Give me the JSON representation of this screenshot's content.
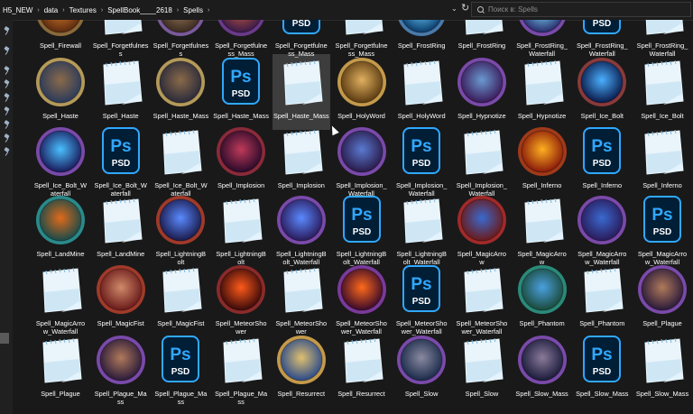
{
  "breadcrumb": [
    "H5_NEW",
    "data",
    "Textures",
    "SpellBook____2618",
    "Spells"
  ],
  "search": {
    "placeholder": "Поиск в: Spells"
  },
  "colors": {
    "background": "#191919",
    "selection": "#3d3d3d",
    "ps_blue": "#31a8ff",
    "ps_bg": "#001e36"
  },
  "icons": {
    "notepad": "notepad-file-icon",
    "psd": "photoshop-psd-icon",
    "spell": "spell-icon"
  },
  "files": [
    [
      {
        "label": "Spell_Firewall",
        "type": "spell",
        "c1": "#d77a2a",
        "c2": "#5a2a10",
        "ring": "#8a6a3a"
      },
      {
        "label": "Spell_Forgetfulnes\ns",
        "type": "notepad"
      },
      {
        "label": "Spell_Forgetfulnes\ns",
        "type": "spell",
        "c1": "#9a7a5a",
        "c2": "#3a2a20",
        "ring": "#7a5a9a"
      },
      {
        "label": "Spell_Forgetfulne\nss_Mass",
        "type": "spell",
        "c1": "#c45a3a",
        "c2": "#3a1a4a",
        "ring": "#6a3a8a"
      },
      {
        "label": "Spell_Forgetfulne\nss_Mass",
        "type": "psd"
      },
      {
        "label": "Spell_Forgetfulne\nss_Mass",
        "type": "notepad"
      },
      {
        "label": "Spell_FrostRing",
        "type": "spell",
        "c1": "#6ad0ff",
        "c2": "#0a3a6a",
        "ring": "#4a7aaa"
      },
      {
        "label": "Spell_FrostRing",
        "type": "notepad"
      },
      {
        "label": "Spell_FrostRing_\nWaterfall",
        "type": "spell",
        "c1": "#7ae0ff",
        "c2": "#2a2a6a",
        "ring": "#7a4aaa"
      },
      {
        "label": "Spell_FrostRing_\nWaterfall",
        "type": "psd"
      },
      {
        "label": "Spell_FrostRing_\nWaterfall",
        "type": "notepad"
      }
    ],
    [
      {
        "label": "Spell_Haste",
        "type": "spell",
        "c1": "#8a6a4a",
        "c2": "#2a3a5a",
        "ring": "#b49a5a"
      },
      {
        "label": "Spell_Haste",
        "type": "notepad"
      },
      {
        "label": "Spell_Haste_Mass",
        "type": "spell",
        "c1": "#8a6a4a",
        "c2": "#2a2a3a",
        "ring": "#b49a5a"
      },
      {
        "label": "Spell_Haste_Mass",
        "type": "psd"
      },
      {
        "label": "Spell_Haste_Mass",
        "type": "notepad",
        "selected": true
      },
      {
        "label": "Spell_HolyWord",
        "type": "spell",
        "c1": "#e0b060",
        "c2": "#5a3a10",
        "ring": "#c49a4a"
      },
      {
        "label": "Spell_HolyWord",
        "type": "notepad"
      },
      {
        "label": "Spell_Hypnotize",
        "type": "spell",
        "c1": "#6a9ad0",
        "c2": "#3a1a5a",
        "ring": "#7a4aaa"
      },
      {
        "label": "Spell_Hypnotize",
        "type": "notepad"
      },
      {
        "label": "Spell_Ice_Bolt",
        "type": "spell",
        "c1": "#4ab0ff",
        "c2": "#0a1a4a",
        "ring": "#8a3a3a"
      },
      {
        "label": "Spell_Ice_Bolt",
        "type": "notepad"
      }
    ],
    [
      {
        "label": "Spell_Ice_Bolt_W\naterfall",
        "type": "spell",
        "c1": "#4ac0ff",
        "c2": "#1a1a5a",
        "ring": "#7a4aaa"
      },
      {
        "label": "Spell_Ice_Bolt_W\naterfall",
        "type": "psd"
      },
      {
        "label": "Spell_Ice_Bolt_W\naterfall",
        "type": "notepad"
      },
      {
        "label": "Spell_Implosion",
        "type": "spell",
        "c1": "#c03a5a",
        "c2": "#2a0a2a",
        "ring": "#8a2a3a"
      },
      {
        "label": "Spell_Implosion",
        "type": "notepad"
      },
      {
        "label": "Spell_Implosion_\nWaterfall",
        "type": "spell",
        "c1": "#5a7ad0",
        "c2": "#2a1a4a",
        "ring": "#7a4aaa"
      },
      {
        "label": "Spell_Implosion_\nWaterfall",
        "type": "psd"
      },
      {
        "label": "Spell_Implosion_\nWaterfall",
        "type": "notepad"
      },
      {
        "label": "Spell_Inferno",
        "type": "spell",
        "c1": "#ffb020",
        "c2": "#8a1a0a",
        "ring": "#a03a1a"
      },
      {
        "label": "Spell_Inferno",
        "type": "psd"
      },
      {
        "label": "Spell_Inferno",
        "type": "notepad"
      }
    ],
    [
      {
        "label": "Spell_LandMine",
        "type": "spell",
        "c1": "#e06a1a",
        "c2": "#1a4a4a",
        "ring": "#2a8a8a"
      },
      {
        "label": "Spell_LandMine",
        "type": "notepad"
      },
      {
        "label": "Spell_LightningB\nolt",
        "type": "spell",
        "c1": "#5a8aff",
        "c2": "#1a1a4a",
        "ring": "#a03a2a"
      },
      {
        "label": "Spell_LightningB\nolt",
        "type": "notepad"
      },
      {
        "label": "Spell_LightningB\nolt_Waterfall",
        "type": "spell",
        "c1": "#5a8aff",
        "c2": "#2a1a5a",
        "ring": "#7a4aaa"
      },
      {
        "label": "Spell_LightningB\nolt_Waterfall",
        "type": "psd"
      },
      {
        "label": "Spell_LightningB\nolt_Waterfall",
        "type": "notepad"
      },
      {
        "label": "Spell_MagicArro\nw",
        "type": "spell",
        "c1": "#3a6ad0",
        "c2": "#6a1a1a",
        "ring": "#a02a2a"
      },
      {
        "label": "Spell_MagicArro\nw",
        "type": "notepad"
      },
      {
        "label": "Spell_MagicArro\nw_Waterfall",
        "type": "spell",
        "c1": "#3a6ad0",
        "c2": "#2a1a5a",
        "ring": "#7a4aaa"
      },
      {
        "label": "Spell_MagicArro\nw_Waterfall",
        "type": "psd"
      }
    ],
    [
      {
        "label": "Spell_MagicArro\nw_Waterfall",
        "type": "notepad"
      },
      {
        "label": "Spell_MagicFist",
        "type": "spell",
        "c1": "#d08a6a",
        "c2": "#6a1a1a",
        "ring": "#a03a2a"
      },
      {
        "label": "Spell_MagicFist",
        "type": "notepad"
      },
      {
        "label": "Spell_MeteorSho\nwer",
        "type": "spell",
        "c1": "#ff5a1a",
        "c2": "#3a0a0a",
        "ring": "#8a2a2a"
      },
      {
        "label": "Spell_MeteorSho\nwer",
        "type": "notepad"
      },
      {
        "label": "Spell_MeteorSho\nwer_Waterfall",
        "type": "spell",
        "c1": "#ff6a1a",
        "c2": "#3a0a2a",
        "ring": "#7a3a9a"
      },
      {
        "label": "Spell_MeteorSho\nwer_Waterfall",
        "type": "psd"
      },
      {
        "label": "Spell_MeteorSho\nwer_Waterfall",
        "type": "notepad"
      },
      {
        "label": "Spell_Phantom",
        "type": "spell",
        "c1": "#4aa0e0",
        "c2": "#1a4a3a",
        "ring": "#2a8a7a"
      },
      {
        "label": "Spell_Phantom",
        "type": "notepad"
      },
      {
        "label": "Spell_Plague",
        "type": "spell",
        "c1": "#b07a5a",
        "c2": "#2a1a3a",
        "ring": "#7a4aaa"
      }
    ],
    [
      {
        "label": "Spell_Plague",
        "type": "notepad"
      },
      {
        "label": "Spell_Plague_Ma\nss",
        "type": "spell",
        "c1": "#b07a5a",
        "c2": "#2a1a3a",
        "ring": "#7a4aaa"
      },
      {
        "label": "Spell_Plague_Ma\nss",
        "type": "psd"
      },
      {
        "label": "Spell_Plague_Ma\nss",
        "type": "notepad"
      },
      {
        "label": "Spell_Resurrect",
        "type": "spell",
        "c1": "#e0c070",
        "c2": "#2a4a8a",
        "ring": "#c49a4a"
      },
      {
        "label": "Spell_Resurrect",
        "type": "notepad"
      },
      {
        "label": "Spell_Slow",
        "type": "spell",
        "c1": "#8a8aa0",
        "c2": "#1a2a4a",
        "ring": "#7a4aaa"
      },
      {
        "label": "Spell_Slow",
        "type": "notepad"
      },
      {
        "label": "Spell_Slow_Mass",
        "type": "spell",
        "c1": "#8a7a9a",
        "c2": "#1a1a3a",
        "ring": "#7a4aaa"
      },
      {
        "label": "Spell_Slow_Mass",
        "type": "psd"
      },
      {
        "label": "Spell_Slow_Mass",
        "type": "notepad"
      }
    ]
  ]
}
